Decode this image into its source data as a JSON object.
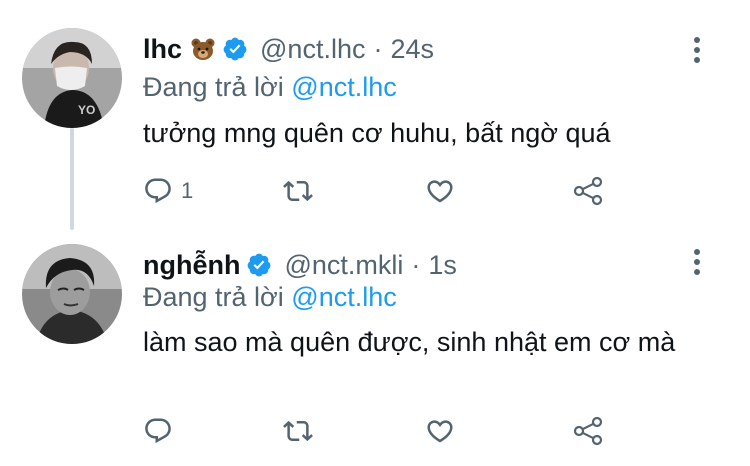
{
  "tweets": [
    {
      "name": "lhc",
      "name_emoji": "bear-emoji",
      "verified": true,
      "handle": "@nct.lhc",
      "separator": "·",
      "time": "24s",
      "reply_prefix": "Đang trả lời",
      "reply_to": "@nct.lhc",
      "text": "tưởng mng quên cơ huhu, bất ngờ quá",
      "reply_count": "1",
      "icons": [
        "comment-icon",
        "retweet-icon",
        "heart-icon",
        "share-icon",
        "more-vertical-icon"
      ]
    },
    {
      "name": "nghễnh",
      "verified": true,
      "handle": "@nct.mkli",
      "separator": "·",
      "time": "1s",
      "reply_prefix": "Đang trả lời",
      "reply_to": "@nct.lhc",
      "text": "làm sao mà quên được, sinh nhật em cơ mà",
      "reply_count": "",
      "icons": [
        "comment-icon",
        "retweet-icon",
        "heart-icon",
        "share-icon",
        "more-vertical-icon"
      ]
    }
  ],
  "colors": {
    "text": "#0f1419",
    "secondary": "#536471",
    "accent": "#1d9bf0",
    "thread_line": "#cfd9de"
  }
}
